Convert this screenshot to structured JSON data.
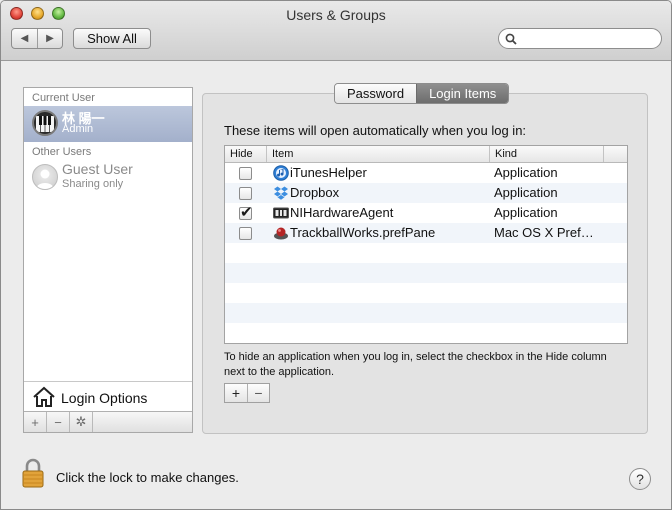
{
  "window": {
    "title": "Users & Groups"
  },
  "toolbar": {
    "back_icon": "chevron-left-icon",
    "forward_icon": "chevron-right-icon",
    "show_all_label": "Show All",
    "search": {
      "value": "",
      "placeholder": ""
    }
  },
  "sidebar": {
    "current_user_header": "Current User",
    "current_user": {
      "name": "林 陽一",
      "role": "Admin",
      "avatar": "piano-keys-avatar"
    },
    "other_users_header": "Other Users",
    "guest_user": {
      "name": "Guest User",
      "role": "Sharing only",
      "avatar": "silhouette-avatar"
    },
    "login_options_label": "Login Options",
    "buttons": {
      "add": "+",
      "remove": "−"
    }
  },
  "tabs": [
    {
      "label": "Password",
      "active": false
    },
    {
      "label": "Login Items",
      "active": true
    }
  ],
  "login_items": {
    "intro": "These items will open automatically when you log in:",
    "columns": {
      "hide": "Hide",
      "item": "Item",
      "kind": "Kind"
    },
    "rows": [
      {
        "hide": false,
        "icon": "itunes-icon",
        "item": "iTunesHelper",
        "kind": "Application"
      },
      {
        "hide": false,
        "icon": "dropbox-icon",
        "item": "Dropbox",
        "kind": "Application"
      },
      {
        "hide": true,
        "icon": "hardware-chip-icon",
        "item": "NIHardwareAgent",
        "kind": "Application"
      },
      {
        "hide": false,
        "icon": "trackball-icon",
        "item": "TrackballWorks.prefPane",
        "kind": "Mac OS X Pref…"
      }
    ],
    "hint": "To hide an application when you log in, select the checkbox in the Hide column next to the application.",
    "add_label": "+",
    "remove_label": "−"
  },
  "footer": {
    "lock_text": "Click the lock to make changes.",
    "help_label": "?"
  }
}
